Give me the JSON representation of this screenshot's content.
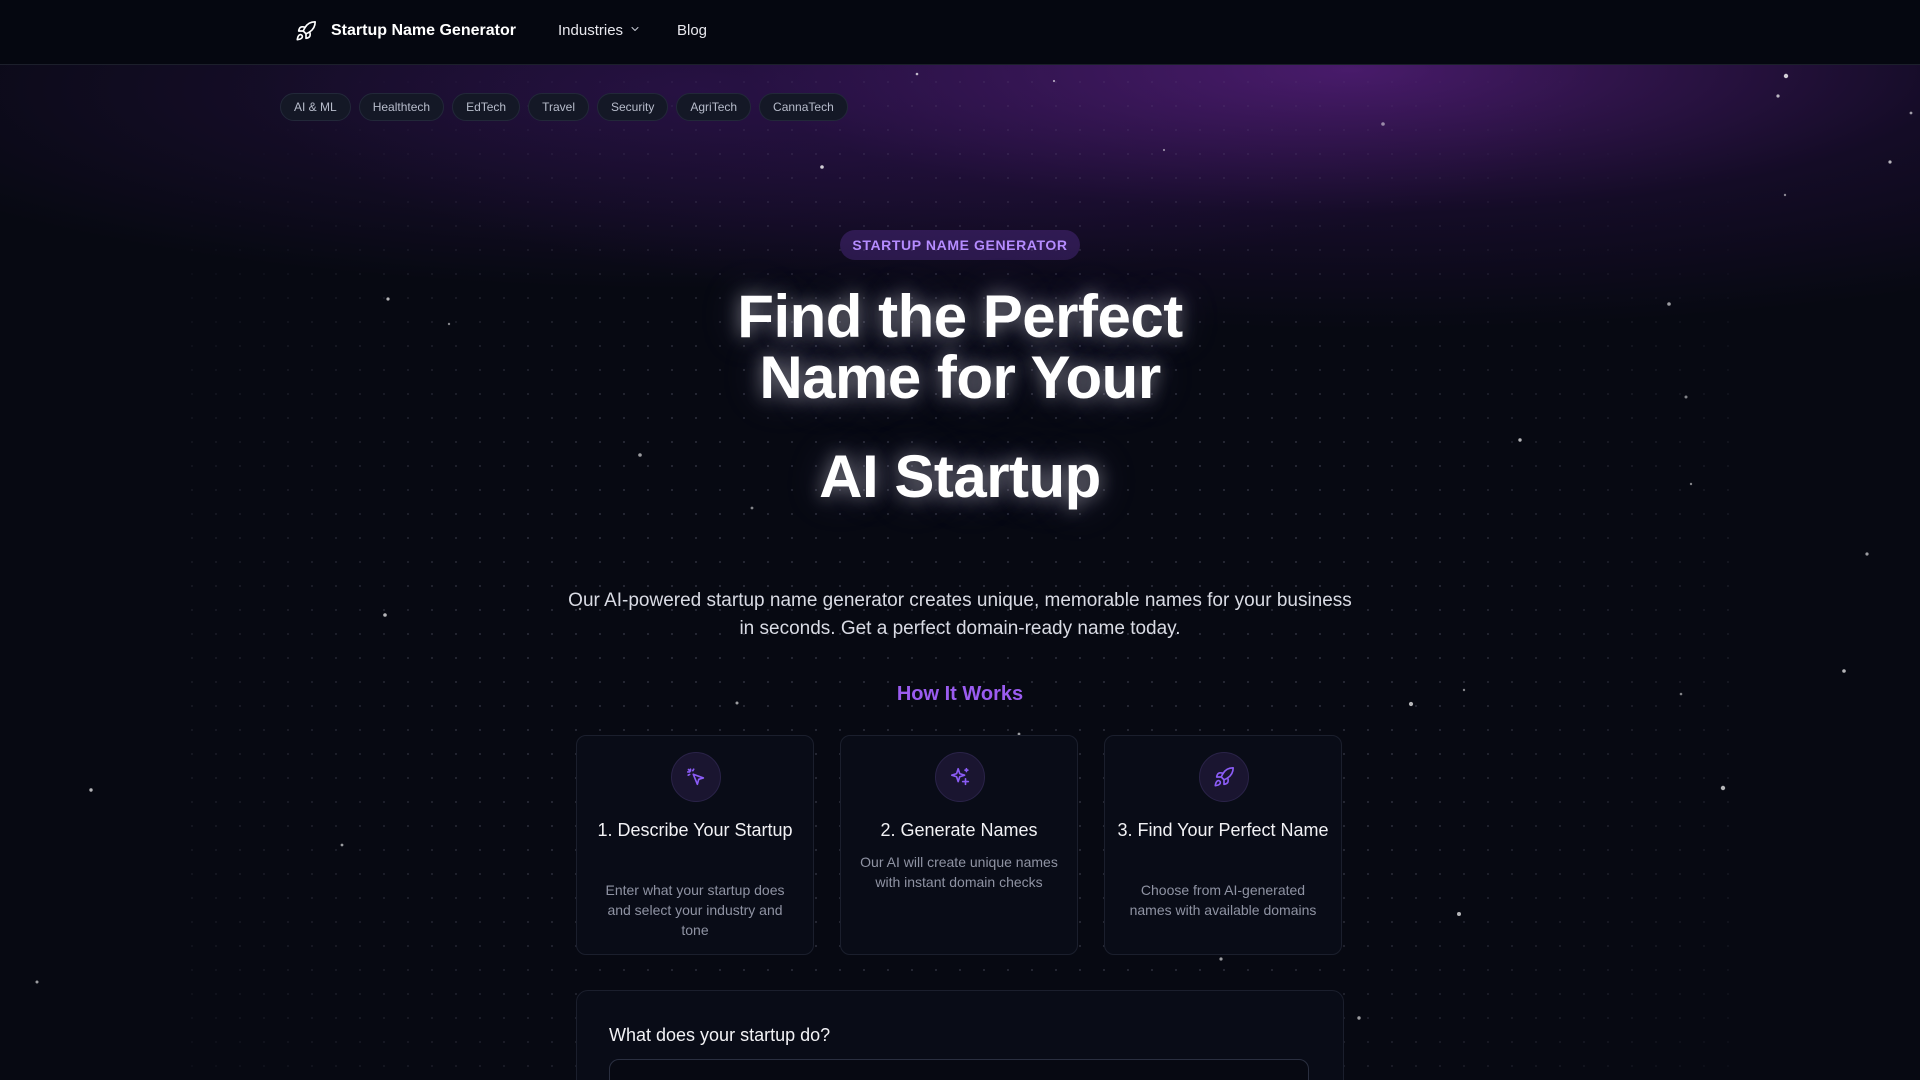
{
  "header": {
    "brand": "Startup Name Generator",
    "nav": {
      "industries": "Industries",
      "blog": "Blog"
    }
  },
  "chips": [
    "AI & ML",
    "Healthtech",
    "EdTech",
    "Travel",
    "Security",
    "AgriTech",
    "CannaTech"
  ],
  "hero": {
    "eyebrow": "STARTUP NAME GENERATOR",
    "title_line1": "Find the Perfect",
    "title_line2": "Name for Your",
    "title_accent": "AI Startup",
    "subtitle": "Our AI-powered startup name generator creates unique, memorable names for your business in seconds. Get a perfect domain-ready name today."
  },
  "how_it_works": {
    "title": "How It Works",
    "steps": [
      {
        "title": "1. Describe Your Startup",
        "description": "Enter what your startup does and select your industry and tone",
        "icon": "pointer-sparkle-icon"
      },
      {
        "title": "2. Generate Names",
        "description": "Our AI will create unique names with instant domain checks",
        "icon": "sparkles-icon"
      },
      {
        "title": "3. Find Your Perfect Name",
        "description": "Choose from AI-generated names with available domains",
        "icon": "rocket-icon"
      }
    ]
  },
  "form": {
    "label": "What does your startup do?",
    "value": "",
    "placeholder": ""
  },
  "colors": {
    "background": "#070912",
    "accent": "#9b5cf0",
    "eyebrow_text": "#b58cff",
    "card_background": "#090c17"
  }
}
